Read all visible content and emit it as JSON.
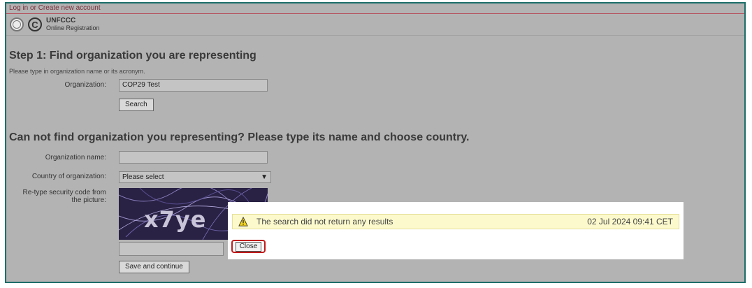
{
  "header": {
    "top_link": "Log in or Create new account",
    "brand_name": "UNFCCC",
    "brand_sub": "Online Registration"
  },
  "step1": {
    "title": "Step 1: Find organization you are representing",
    "hint": "Please type in organization name or its acronym.",
    "org_label": "Organization:",
    "org_value": "COP29 Test",
    "search_label": "Search"
  },
  "step2": {
    "title": "Can not find organization you representing? Please type its name and choose country.",
    "name_label": "Organization name:",
    "name_value": "",
    "country_label": "Country of organization:",
    "country_selected": "Please select",
    "security_label_1": "Re-type security code from",
    "security_label_2": "the picture:",
    "captcha_text": "x7ye",
    "security_value": "",
    "save_label": "Save and continue"
  },
  "dialog": {
    "message": "The search did not return any results",
    "timestamp": "02 Jul 2024 09:41 CET",
    "close_label": "Close"
  },
  "colors": {
    "frame": "#1d6e6a",
    "alert_bg": "#fcfacd",
    "highlight": "#c11a1a"
  }
}
